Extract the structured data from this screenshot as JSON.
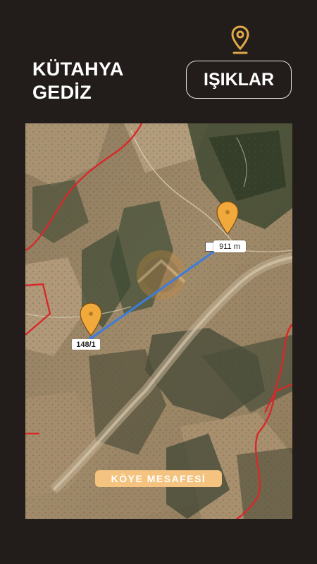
{
  "header": {
    "city": "KÜTAHYA",
    "district": "GEDİZ",
    "village_button": "IŞIKLAR",
    "pin_icon": "location-pin-icon"
  },
  "map": {
    "parcel_label": "148/1",
    "distance_label": "911 m",
    "caption": "KÖYE MESAFESİ",
    "colors": {
      "marker": "#f2a93b",
      "route": "#3b7ddd",
      "boundary": "#d8282a",
      "accent": "#f4c37f",
      "background": "#221d1a"
    }
  }
}
